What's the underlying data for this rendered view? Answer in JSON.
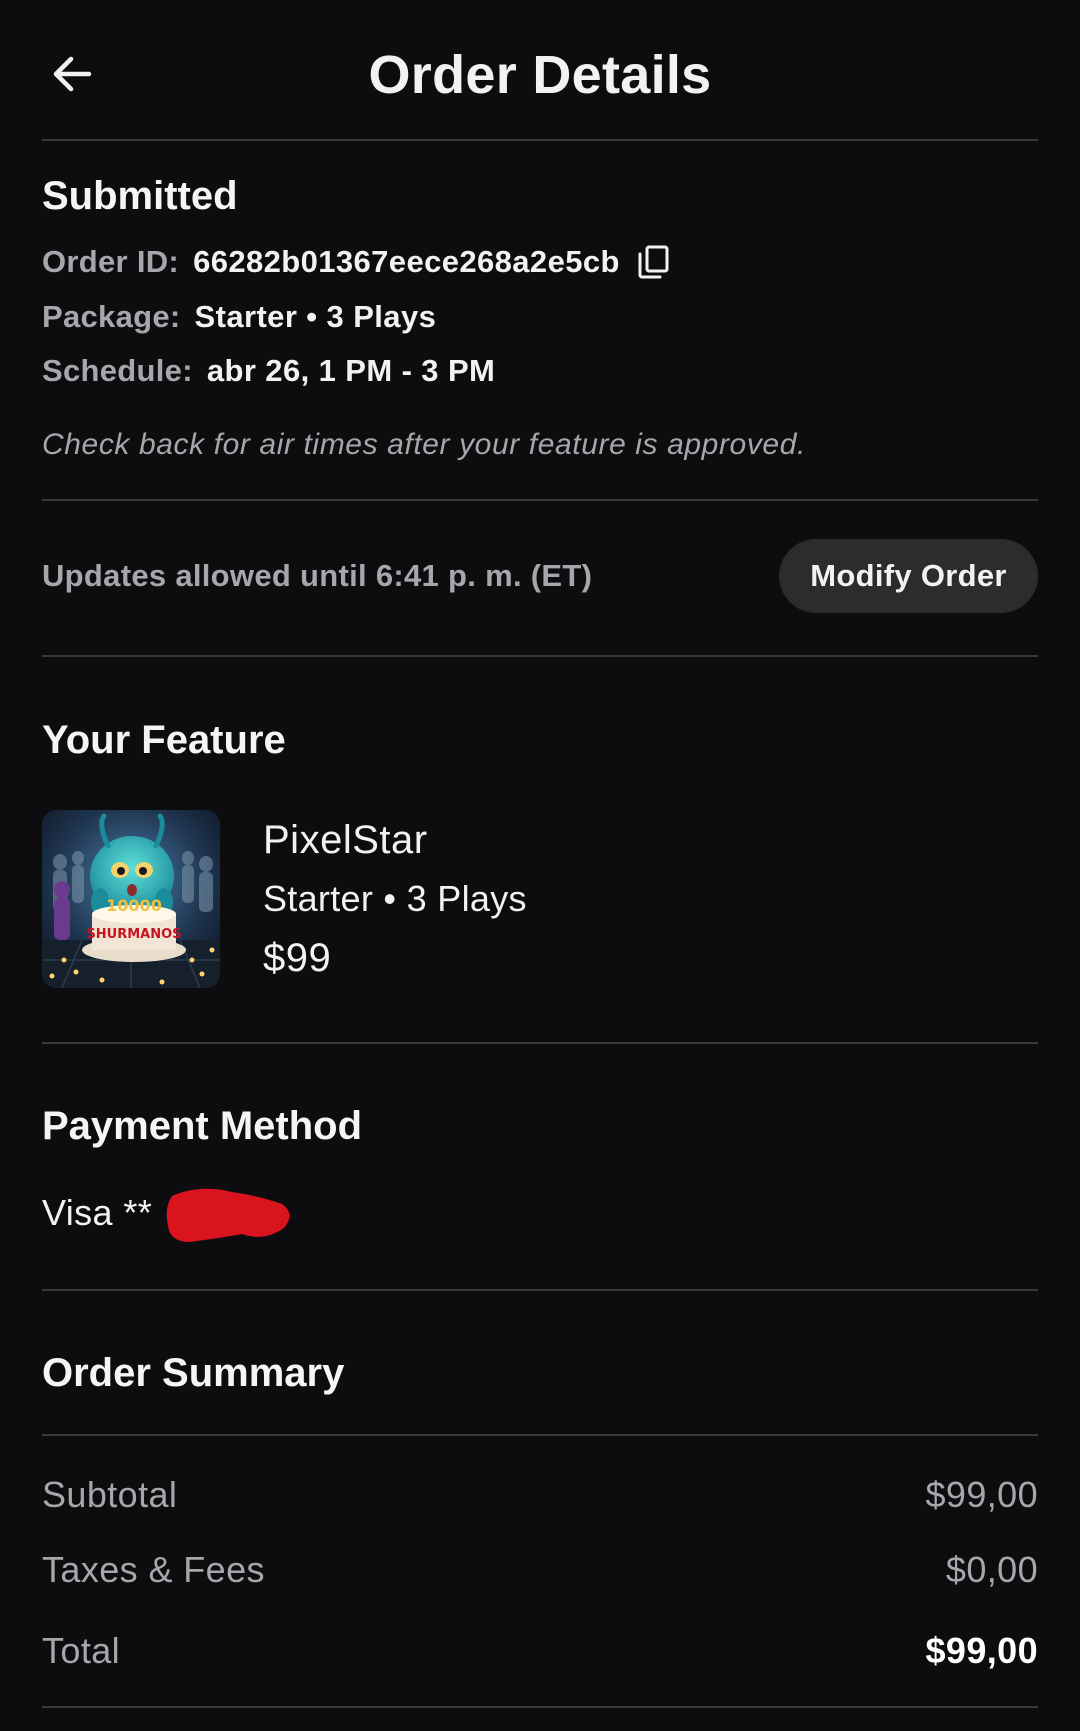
{
  "header": {
    "title": "Order Details",
    "back_icon": "arrow-left-icon"
  },
  "order": {
    "status": "Submitted",
    "id_label": "Order ID:",
    "id_value": "66282b01367eece268a2e5cb",
    "copy_icon": "copy-icon",
    "package_label": "Package:",
    "package_value": "Starter • 3 Plays",
    "schedule_label": "Schedule:",
    "schedule_value": "abr 26, 1 PM - 3 PM",
    "note": "Check back for air times after your feature is approved."
  },
  "updates": {
    "text": "Updates allowed until 6:41 p. m. (ET)",
    "modify_button": "Modify Order"
  },
  "feature": {
    "heading": "Your Feature",
    "thumbnail_text_top": "10000",
    "thumbnail_text_bottom": "SHURMANOS",
    "name": "PixelStar",
    "package": "Starter • 3 Plays",
    "price": "$99"
  },
  "payment": {
    "heading": "Payment Method",
    "card": "Visa **"
  },
  "summary": {
    "heading": "Order Summary",
    "rows": [
      {
        "label": "Subtotal",
        "value": "$99,00"
      },
      {
        "label": "Taxes & Fees",
        "value": "$0,00"
      },
      {
        "label": "Total",
        "value": "$99,00"
      }
    ]
  },
  "colors": {
    "background": "#0d0d10",
    "divider": "#3a3a3e",
    "muted_text": "#a7a7ab",
    "button_bg": "#2c2c2f",
    "redaction": "#d9141f"
  }
}
